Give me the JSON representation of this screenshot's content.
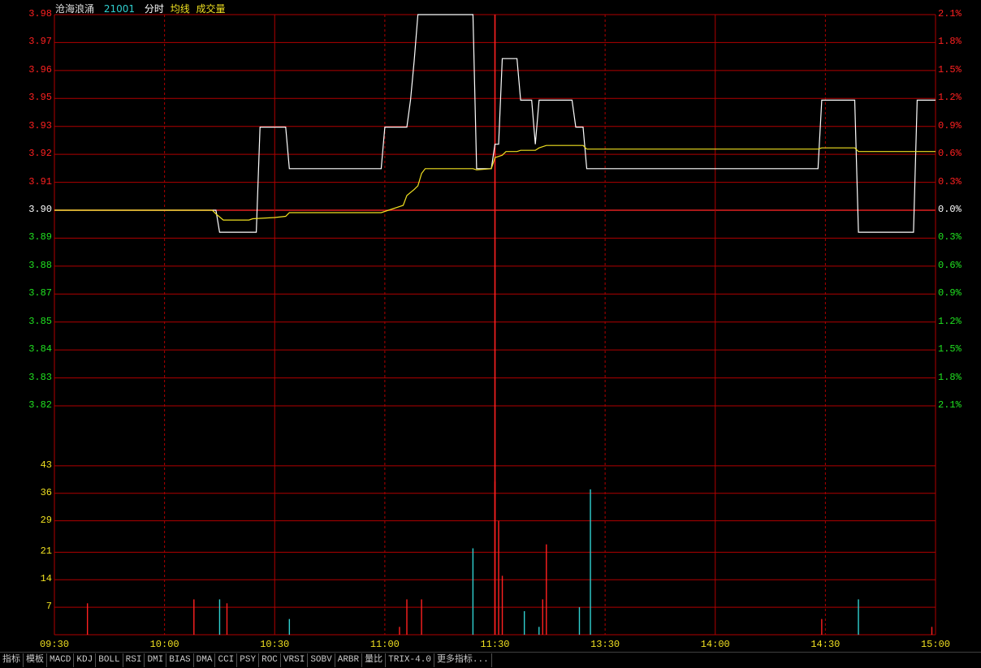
{
  "header": {
    "stock_name": "沧海浪涌",
    "stock_code": "21001",
    "series_labels": [
      "分时",
      "均线",
      "成交量"
    ]
  },
  "colors": {
    "background": "#000000",
    "grid": "#b00000",
    "price_line": "#ffffff",
    "avg_line": "#f0e020",
    "up": "#ff2020",
    "down": "#20e020",
    "neutral": "#ffffff",
    "volume_up": "#ff2020",
    "volume_down": "#30d0d0"
  },
  "chart_data": {
    "type": "line",
    "base_price": 3.9,
    "price_axis": {
      "labels": [
        "3.98",
        "3.97",
        "3.96",
        "3.95",
        "3.93",
        "3.92",
        "3.91",
        "3.90",
        "3.89",
        "3.88",
        "3.87",
        "3.85",
        "3.84",
        "3.83",
        "3.82"
      ],
      "ylim": [
        3.82,
        3.98
      ]
    },
    "percent_axis": {
      "labels": [
        "2.1%",
        "1.8%",
        "1.5%",
        "1.2%",
        "0.9%",
        "0.6%",
        "0.3%",
        "0.0%",
        "0.3%",
        "0.6%",
        "0.9%",
        "1.2%",
        "1.5%",
        "1.8%",
        "2.1%"
      ]
    },
    "volume_axis": {
      "labels": [
        "43",
        "36",
        "29",
        "21",
        "14",
        "7"
      ],
      "ylim": [
        0,
        50
      ]
    },
    "x_axis": {
      "labels": [
        "09:30",
        "10:00",
        "10:30",
        "11:00",
        "11:30",
        "13:30",
        "14:00",
        "14:30",
        "15:00"
      ],
      "range_minutes": [
        0,
        240
      ]
    },
    "series": [
      {
        "name": "分时",
        "points": [
          [
            0,
            3.9
          ],
          [
            44,
            3.9
          ],
          [
            45,
            3.891
          ],
          [
            55,
            3.891
          ],
          [
            56,
            3.934
          ],
          [
            63,
            3.934
          ],
          [
            64,
            3.917
          ],
          [
            89,
            3.917
          ],
          [
            90,
            3.934
          ],
          [
            96,
            3.934
          ],
          [
            97,
            3.945
          ],
          [
            98,
            3.961
          ],
          [
            99,
            3.98
          ],
          [
            114,
            3.98
          ],
          [
            115,
            3.917
          ],
          [
            119,
            3.917
          ],
          [
            120,
            3.927
          ],
          [
            121,
            3.927
          ],
          [
            122,
            3.962
          ],
          [
            126,
            3.962
          ],
          [
            127,
            3.945
          ],
          [
            130,
            3.945
          ],
          [
            131,
            3.927
          ],
          [
            132,
            3.945
          ],
          [
            141,
            3.945
          ],
          [
            142,
            3.934
          ],
          [
            144,
            3.934
          ],
          [
            145,
            3.917
          ],
          [
            208,
            3.917
          ],
          [
            209,
            3.945
          ],
          [
            218,
            3.945
          ],
          [
            219,
            3.891
          ],
          [
            234,
            3.891
          ],
          [
            235,
            3.945
          ],
          [
            240,
            3.945
          ]
        ]
      },
      {
        "name": "均线",
        "points": [
          [
            0,
            3.9
          ],
          [
            43,
            3.9
          ],
          [
            44,
            3.8985
          ],
          [
            46,
            3.896
          ],
          [
            53,
            3.896
          ],
          [
            54,
            3.8965
          ],
          [
            60,
            3.897
          ],
          [
            63,
            3.8975
          ],
          [
            64,
            3.899
          ],
          [
            89,
            3.899
          ],
          [
            91,
            3.9
          ],
          [
            95,
            3.902
          ],
          [
            96,
            3.906
          ],
          [
            98,
            3.9085
          ],
          [
            99,
            3.91
          ],
          [
            100,
            3.915
          ],
          [
            101,
            3.917
          ],
          [
            114,
            3.917
          ],
          [
            115,
            3.9165
          ],
          [
            119,
            3.917
          ],
          [
            120,
            3.9215
          ],
          [
            122,
            3.9225
          ],
          [
            123,
            3.924
          ],
          [
            126,
            3.924
          ],
          [
            127,
            3.9245
          ],
          [
            131,
            3.9245
          ],
          [
            132,
            3.9255
          ],
          [
            134,
            3.9265
          ],
          [
            144,
            3.9265
          ],
          [
            145,
            3.925
          ],
          [
            208,
            3.925
          ],
          [
            209,
            3.9255
          ],
          [
            218,
            3.9255
          ],
          [
            219,
            3.924
          ],
          [
            240,
            3.924
          ]
        ]
      }
    ],
    "volume": [
      {
        "t": 9,
        "v": 8,
        "dir": "up"
      },
      {
        "t": 38,
        "v": 9,
        "dir": "up"
      },
      {
        "t": 45,
        "v": 9,
        "dir": "down"
      },
      {
        "t": 47,
        "v": 8,
        "dir": "up"
      },
      {
        "t": 64,
        "v": 4,
        "dir": "down"
      },
      {
        "t": 94,
        "v": 2,
        "dir": "up"
      },
      {
        "t": 96,
        "v": 9,
        "dir": "up"
      },
      {
        "t": 100,
        "v": 9,
        "dir": "up"
      },
      {
        "t": 114,
        "v": 22,
        "dir": "down"
      },
      {
        "t": 120,
        "v": 39,
        "dir": "up"
      },
      {
        "t": 121,
        "v": 29,
        "dir": "up"
      },
      {
        "t": 122,
        "v": 15,
        "dir": "up"
      },
      {
        "t": 128,
        "v": 6,
        "dir": "down"
      },
      {
        "t": 132,
        "v": 2,
        "dir": "down"
      },
      {
        "t": 133,
        "v": 9,
        "dir": "up"
      },
      {
        "t": 134,
        "v": 23,
        "dir": "up"
      },
      {
        "t": 143,
        "v": 7,
        "dir": "down"
      },
      {
        "t": 146,
        "v": 37,
        "dir": "down"
      },
      {
        "t": 209,
        "v": 4,
        "dir": "up"
      },
      {
        "t": 219,
        "v": 9,
        "dir": "down"
      },
      {
        "t": 239,
        "v": 2,
        "dir": "up"
      }
    ]
  },
  "tabs": [
    "指标",
    "模板",
    "MACD",
    "KDJ",
    "BOLL",
    "RSI",
    "DMI",
    "BIAS",
    "DMA",
    "CCI",
    "PSY",
    "ROC",
    "VRSI",
    "SOBV",
    "ARBR",
    "量比",
    "TRIX-4.0",
    "更多指标..."
  ]
}
